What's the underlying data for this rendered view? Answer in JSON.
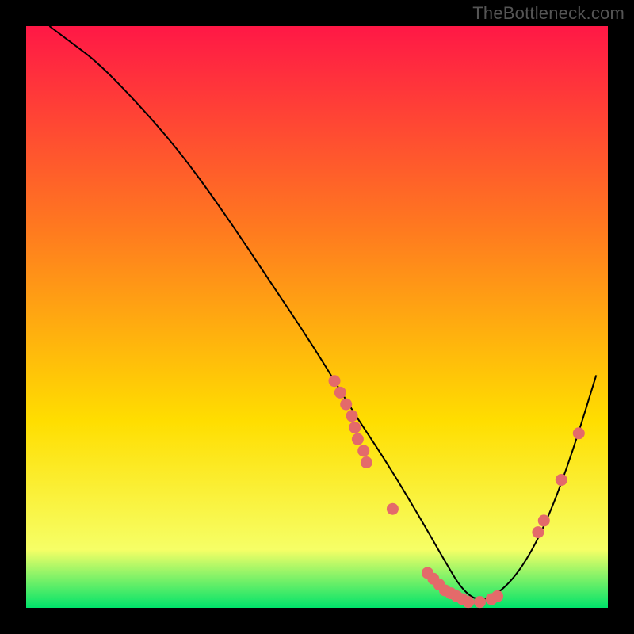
{
  "watermark": "TheBottleneck.com",
  "chart_data": {
    "type": "line",
    "title": "",
    "xlabel": "",
    "ylabel": "",
    "xlim": [
      0,
      100
    ],
    "ylim": [
      0,
      100
    ],
    "grid": false,
    "legend": false,
    "background_gradient": {
      "top": "#ff1846",
      "mid": "#ffde00",
      "bottom": "#00e36a"
    },
    "series": [
      {
        "name": "bottleneck-curve",
        "x": [
          4,
          8,
          12,
          18,
          26,
          34,
          42,
          50,
          56,
          62,
          68,
          72,
          75,
          78,
          82,
          86,
          90,
          94,
          98
        ],
        "y": [
          100,
          97,
          94,
          88,
          79,
          68,
          56,
          44,
          34,
          25,
          15,
          8,
          3,
          1,
          3,
          8,
          16,
          27,
          40
        ]
      }
    ],
    "scatter": {
      "name": "data-points",
      "color": "#e46a6a",
      "points": [
        {
          "x": 53,
          "y": 39
        },
        {
          "x": 54,
          "y": 37
        },
        {
          "x": 55,
          "y": 35
        },
        {
          "x": 56,
          "y": 33
        },
        {
          "x": 56.5,
          "y": 31
        },
        {
          "x": 57,
          "y": 29
        },
        {
          "x": 58,
          "y": 27
        },
        {
          "x": 58.5,
          "y": 25
        },
        {
          "x": 63,
          "y": 17
        },
        {
          "x": 69,
          "y": 6
        },
        {
          "x": 70,
          "y": 5
        },
        {
          "x": 71,
          "y": 4
        },
        {
          "x": 72,
          "y": 3
        },
        {
          "x": 73,
          "y": 2.5
        },
        {
          "x": 74,
          "y": 2
        },
        {
          "x": 75,
          "y": 1.5
        },
        {
          "x": 76,
          "y": 1
        },
        {
          "x": 78,
          "y": 1
        },
        {
          "x": 80,
          "y": 1.5
        },
        {
          "x": 81,
          "y": 2
        },
        {
          "x": 88,
          "y": 13
        },
        {
          "x": 89,
          "y": 15
        },
        {
          "x": 92,
          "y": 22
        },
        {
          "x": 95,
          "y": 30
        }
      ]
    }
  }
}
